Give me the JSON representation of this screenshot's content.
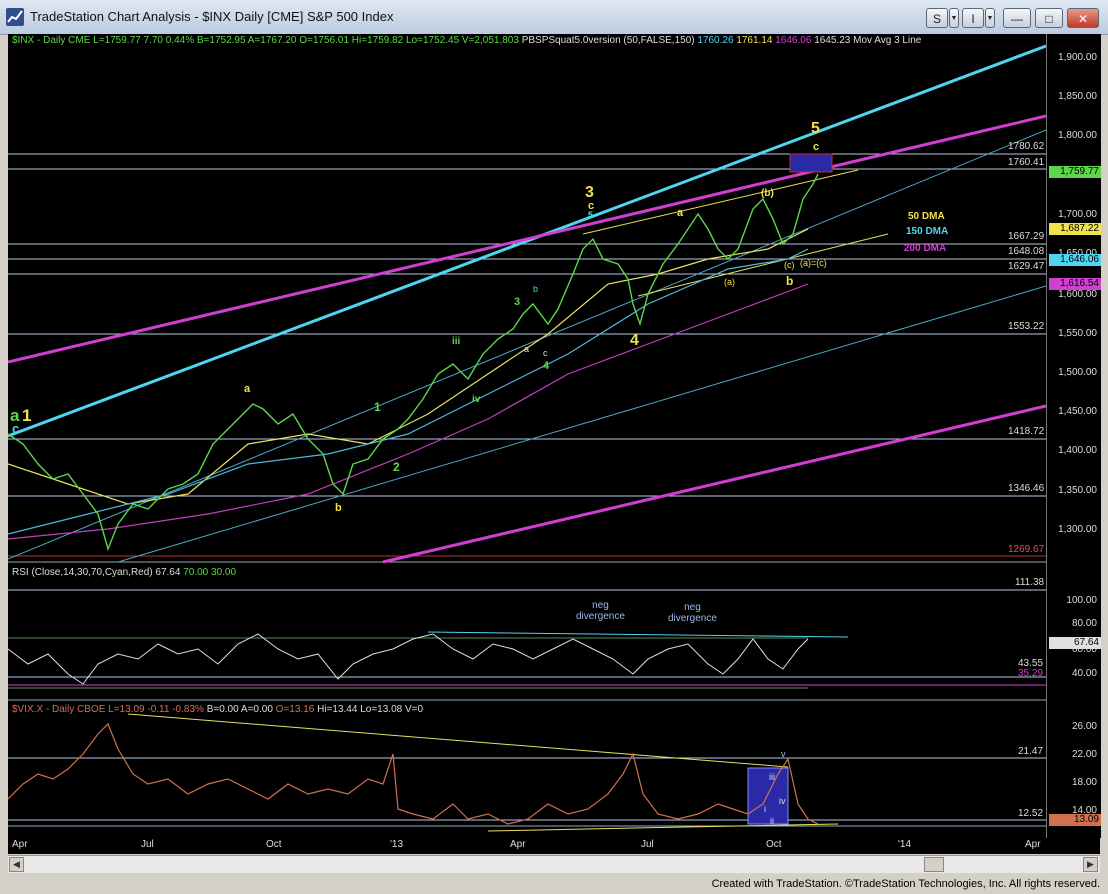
{
  "window": {
    "title": "TradeStation Chart Analysis - $INX Daily [CME] S&P 500 Index",
    "btn_s": "S",
    "btn_i": "I",
    "btn_min": "—",
    "btn_max": "□",
    "btn_close": "✕"
  },
  "price_legend": {
    "symbol": "$INX - Daily",
    "exchange": "CME",
    "last": "L=1759.77",
    "change": "7.70",
    "pct": "0.44%",
    "bid": "B=1752.95",
    "ask": "A=1767.20",
    "open": "O=1756.01",
    "high": "Hi=1759.82",
    "low": "Lo=1752.45",
    "volume": "V=2,051,803",
    "indicator": "PBSPSquat5.0version (50,FALSE,150)",
    "ind_v1": "1760.26",
    "ind_v2": "1761.14",
    "ind_v3": "1646.06",
    "ind_v4": "1645.23",
    "ma_label": "Mov Avg 3 Line"
  },
  "price_axis": [
    "1,900.00",
    "1,850.00",
    "1,800.00",
    "1,750.00",
    "1,700.00",
    "1,650.00",
    "1,600.00",
    "1,550.00",
    "1,500.00",
    "1,450.00",
    "1,400.00",
    "1,350.00",
    "1,300.00"
  ],
  "price_boxes": {
    "last": "1,759.77",
    "ma50": "1,687.22",
    "ma150": "1,646.06",
    "ma200": "1,616.54"
  },
  "hlines": [
    "1780.62",
    "1760.41",
    "1667.29",
    "1648.08",
    "1629.47",
    "1553.22",
    "1418.72",
    "1346.46",
    "1269.67"
  ],
  "dma_labels": {
    "d50": "50 DMA",
    "d150": "150 DMA",
    "d200": "200 DMA"
  },
  "waves": {
    "a1_a": "a",
    "a1_1": "1",
    "a1_c": "c",
    "w3": "3",
    "w3c": "c",
    "w3_5": "5",
    "w4": "4",
    "w5": "5",
    "w5c": "c",
    "sub_a": "a",
    "sub_b": "b",
    "g1": "1",
    "g2": "2",
    "g3": "3",
    "g4": "4",
    "iii": "iii",
    "iv": "iv",
    "mini_a": "a",
    "mini_b": "b",
    "mini_c": "c",
    "jul_a": "a",
    "pb": "(b)",
    "pa": "(a)",
    "pc": "(c)",
    "aeqc": "(a)=(c)",
    "b2": "b"
  },
  "rsi_legend": {
    "name": "RSI (Close,14,30,70,Cyan,Red)",
    "v1": "67.64",
    "v2": "70.00",
    "v3": "30.00"
  },
  "rsi_axis": [
    "100.00",
    "80.00",
    "60.00",
    "40.00"
  ],
  "rsi_hlines": [
    "111.38",
    "43.55",
    "35.29"
  ],
  "rsi_box": "67.64",
  "rsi_notes": {
    "neg1": "neg",
    "div1": "divergence",
    "neg2": "neg",
    "div2": "divergence"
  },
  "vix_legend": {
    "symbol": "$VIX.X - Daily",
    "exchange": "CBOE",
    "last": "L=13.09",
    "change": "-0.11",
    "pct": "-0.83%",
    "bid": "B=0.00",
    "ask": "A=0.00",
    "open": "O=13.16",
    "high": "Hi=13.44",
    "low": "Lo=13.08",
    "volume": "V=0"
  },
  "vix_axis": [
    "26.00",
    "22.00",
    "18.00",
    "14.00"
  ],
  "vix_hlines": [
    "21.47",
    "12.52"
  ],
  "vix_box": "13.09",
  "vix_waves": {
    "v": "v",
    "iii": "iii",
    "iv": "iv",
    "ii": "ii",
    "i": "i"
  },
  "x_axis": [
    "Apr",
    "Jul",
    "Oct",
    "'13",
    "Apr",
    "Jul",
    "Oct",
    "'14",
    "Apr"
  ],
  "footer": "Created with TradeStation. ©TradeStation Technologies, Inc. All rights reserved.",
  "colors": {
    "yellow": "#f2e24a",
    "cyan": "#4fd5f0",
    "magenta": "#d040d0",
    "green": "#5cd64a"
  }
}
